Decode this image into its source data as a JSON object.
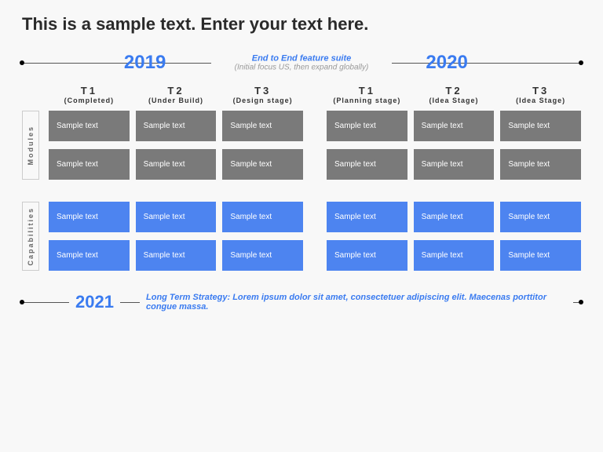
{
  "title": "This is a sample text. Enter your text here.",
  "timeline": {
    "year_left": "2019",
    "year_right": "2020",
    "center_line1": "End to End feature suite",
    "center_line2": "(Initial focus US, then expand globally)"
  },
  "stages": {
    "left": [
      {
        "t": "T1",
        "s": "(Completed)"
      },
      {
        "t": "T2",
        "s": "(Under Build)"
      },
      {
        "t": "T3",
        "s": "(Design stage)"
      }
    ],
    "right": [
      {
        "t": "T1",
        "s": "(Planning stage)"
      },
      {
        "t": "T2",
        "s": "(Idea Stage)"
      },
      {
        "t": "T3",
        "s": "(Idea Stage)"
      }
    ]
  },
  "categories": [
    {
      "name": "Modules",
      "style": "gray",
      "left_rows": [
        [
          "Sample text",
          "Sample text",
          "Sample text"
        ],
        [
          "Sample text",
          "Sample text",
          "Sample text"
        ]
      ],
      "right_rows": [
        [
          "Sample text",
          "Sample text",
          "Sample text"
        ],
        [
          "Sample text",
          "Sample text",
          "Sample text"
        ]
      ]
    },
    {
      "name": "Capabilities",
      "style": "blue",
      "left_rows": [
        [
          "Sample text",
          "Sample text",
          "Sample text"
        ],
        [
          "Sample text",
          "Sample text",
          "Sample text"
        ]
      ],
      "right_rows": [
        [
          "Sample text",
          "Sample text",
          "Sample text"
        ],
        [
          "Sample text",
          "Sample text",
          "Sample text"
        ]
      ]
    }
  ],
  "footer": {
    "year": "2021",
    "text": "Long Term Strategy:  Lorem ipsum dolor sit amet, consectetuer adipiscing elit. Maecenas porttitor congue massa."
  }
}
